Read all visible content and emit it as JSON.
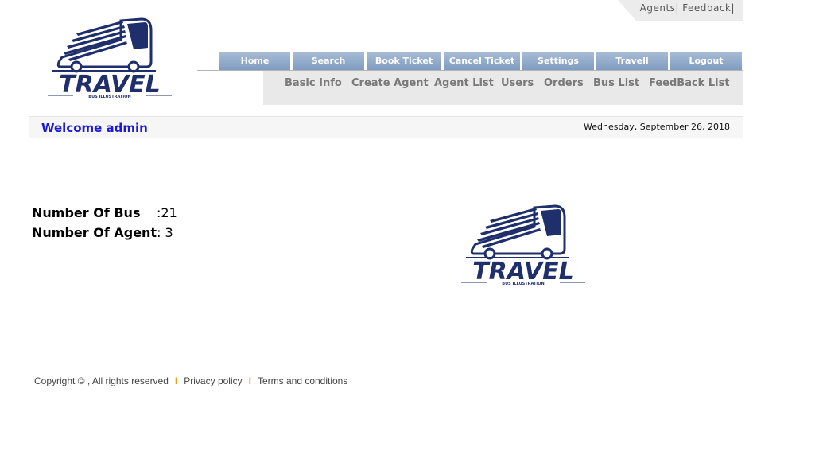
{
  "top_links": {
    "agents": "Agents",
    "feedback": "Feedback",
    "sep": "|"
  },
  "logo": {
    "title": "TRAVEL",
    "subtitle": "BUS ILLUSTRATION",
    "color": "#1f2f6b"
  },
  "main_nav": [
    {
      "label": "Home"
    },
    {
      "label": "Search"
    },
    {
      "label": "Book Ticket"
    },
    {
      "label": "Cancel Ticket"
    },
    {
      "label": "Settings"
    },
    {
      "label": "Travell"
    },
    {
      "label": "Logout"
    }
  ],
  "sub_nav": [
    {
      "label": "Basic Info"
    },
    {
      "label": "Create Agent"
    },
    {
      "label": "Agent List"
    },
    {
      "label": "Users"
    },
    {
      "label": "Orders"
    },
    {
      "label": "Bus List"
    },
    {
      "label": "FeedBack List"
    }
  ],
  "welcome": {
    "text": "Welcome admin",
    "date": "Wednesday, September 26, 2018"
  },
  "stats": {
    "bus_label": "Number Of Bus",
    "bus_value": ":21",
    "agent_label": "Number Of Agent",
    "agent_value": ": 3"
  },
  "footer": {
    "copyright": "Copyright © , All rights reserved",
    "sep": "I",
    "privacy": "Privacy policy",
    "terms": "Terms and conditions"
  },
  "colors": {
    "nav_tab": "#8fa8c9",
    "welcome_text": "#1a1ad8",
    "footer_sep": "#f0a020",
    "logo": "#1f2f6b"
  }
}
